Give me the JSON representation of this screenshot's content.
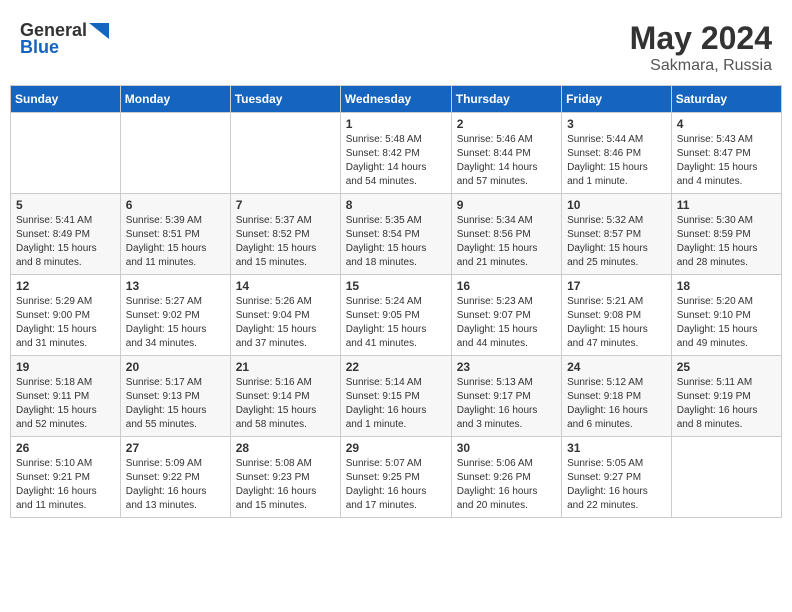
{
  "header": {
    "logo_line1": "General",
    "logo_line2": "Blue",
    "month_year": "May 2024",
    "location": "Sakmara, Russia"
  },
  "days_of_week": [
    "Sunday",
    "Monday",
    "Tuesday",
    "Wednesday",
    "Thursday",
    "Friday",
    "Saturday"
  ],
  "weeks": [
    [
      {
        "day": "",
        "info": ""
      },
      {
        "day": "",
        "info": ""
      },
      {
        "day": "",
        "info": ""
      },
      {
        "day": "1",
        "info": "Sunrise: 5:48 AM\nSunset: 8:42 PM\nDaylight: 14 hours\nand 54 minutes."
      },
      {
        "day": "2",
        "info": "Sunrise: 5:46 AM\nSunset: 8:44 PM\nDaylight: 14 hours\nand 57 minutes."
      },
      {
        "day": "3",
        "info": "Sunrise: 5:44 AM\nSunset: 8:46 PM\nDaylight: 15 hours\nand 1 minute."
      },
      {
        "day": "4",
        "info": "Sunrise: 5:43 AM\nSunset: 8:47 PM\nDaylight: 15 hours\nand 4 minutes."
      }
    ],
    [
      {
        "day": "5",
        "info": "Sunrise: 5:41 AM\nSunset: 8:49 PM\nDaylight: 15 hours\nand 8 minutes."
      },
      {
        "day": "6",
        "info": "Sunrise: 5:39 AM\nSunset: 8:51 PM\nDaylight: 15 hours\nand 11 minutes."
      },
      {
        "day": "7",
        "info": "Sunrise: 5:37 AM\nSunset: 8:52 PM\nDaylight: 15 hours\nand 15 minutes."
      },
      {
        "day": "8",
        "info": "Sunrise: 5:35 AM\nSunset: 8:54 PM\nDaylight: 15 hours\nand 18 minutes."
      },
      {
        "day": "9",
        "info": "Sunrise: 5:34 AM\nSunset: 8:56 PM\nDaylight: 15 hours\nand 21 minutes."
      },
      {
        "day": "10",
        "info": "Sunrise: 5:32 AM\nSunset: 8:57 PM\nDaylight: 15 hours\nand 25 minutes."
      },
      {
        "day": "11",
        "info": "Sunrise: 5:30 AM\nSunset: 8:59 PM\nDaylight: 15 hours\nand 28 minutes."
      }
    ],
    [
      {
        "day": "12",
        "info": "Sunrise: 5:29 AM\nSunset: 9:00 PM\nDaylight: 15 hours\nand 31 minutes."
      },
      {
        "day": "13",
        "info": "Sunrise: 5:27 AM\nSunset: 9:02 PM\nDaylight: 15 hours\nand 34 minutes."
      },
      {
        "day": "14",
        "info": "Sunrise: 5:26 AM\nSunset: 9:04 PM\nDaylight: 15 hours\nand 37 minutes."
      },
      {
        "day": "15",
        "info": "Sunrise: 5:24 AM\nSunset: 9:05 PM\nDaylight: 15 hours\nand 41 minutes."
      },
      {
        "day": "16",
        "info": "Sunrise: 5:23 AM\nSunset: 9:07 PM\nDaylight: 15 hours\nand 44 minutes."
      },
      {
        "day": "17",
        "info": "Sunrise: 5:21 AM\nSunset: 9:08 PM\nDaylight: 15 hours\nand 47 minutes."
      },
      {
        "day": "18",
        "info": "Sunrise: 5:20 AM\nSunset: 9:10 PM\nDaylight: 15 hours\nand 49 minutes."
      }
    ],
    [
      {
        "day": "19",
        "info": "Sunrise: 5:18 AM\nSunset: 9:11 PM\nDaylight: 15 hours\nand 52 minutes."
      },
      {
        "day": "20",
        "info": "Sunrise: 5:17 AM\nSunset: 9:13 PM\nDaylight: 15 hours\nand 55 minutes."
      },
      {
        "day": "21",
        "info": "Sunrise: 5:16 AM\nSunset: 9:14 PM\nDaylight: 15 hours\nand 58 minutes."
      },
      {
        "day": "22",
        "info": "Sunrise: 5:14 AM\nSunset: 9:15 PM\nDaylight: 16 hours\nand 1 minute."
      },
      {
        "day": "23",
        "info": "Sunrise: 5:13 AM\nSunset: 9:17 PM\nDaylight: 16 hours\nand 3 minutes."
      },
      {
        "day": "24",
        "info": "Sunrise: 5:12 AM\nSunset: 9:18 PM\nDaylight: 16 hours\nand 6 minutes."
      },
      {
        "day": "25",
        "info": "Sunrise: 5:11 AM\nSunset: 9:19 PM\nDaylight: 16 hours\nand 8 minutes."
      }
    ],
    [
      {
        "day": "26",
        "info": "Sunrise: 5:10 AM\nSunset: 9:21 PM\nDaylight: 16 hours\nand 11 minutes."
      },
      {
        "day": "27",
        "info": "Sunrise: 5:09 AM\nSunset: 9:22 PM\nDaylight: 16 hours\nand 13 minutes."
      },
      {
        "day": "28",
        "info": "Sunrise: 5:08 AM\nSunset: 9:23 PM\nDaylight: 16 hours\nand 15 minutes."
      },
      {
        "day": "29",
        "info": "Sunrise: 5:07 AM\nSunset: 9:25 PM\nDaylight: 16 hours\nand 17 minutes."
      },
      {
        "day": "30",
        "info": "Sunrise: 5:06 AM\nSunset: 9:26 PM\nDaylight: 16 hours\nand 20 minutes."
      },
      {
        "day": "31",
        "info": "Sunrise: 5:05 AM\nSunset: 9:27 PM\nDaylight: 16 hours\nand 22 minutes."
      },
      {
        "day": "",
        "info": ""
      }
    ]
  ]
}
